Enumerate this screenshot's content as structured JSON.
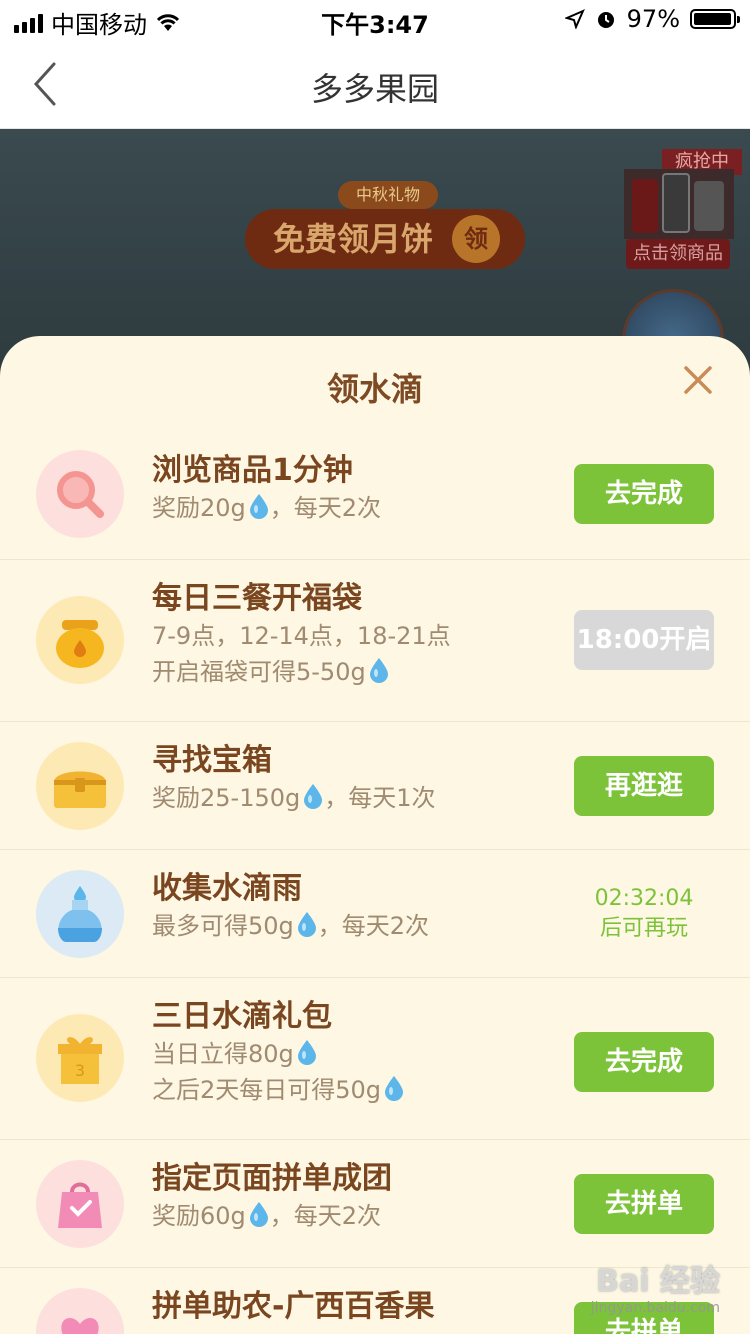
{
  "status_bar": {
    "carrier": "中国移动",
    "time": "下午3:47",
    "battery": "97%",
    "battery_level": 0.97
  },
  "nav": {
    "title": "多多果园"
  },
  "background": {
    "banner_sub": "中秋礼物",
    "banner_main": "免费领月饼",
    "banner_badge": "领",
    "crazy_tag": "疯抢中",
    "click_product": "点击领商品"
  },
  "sheet": {
    "title": "领水滴",
    "tasks": [
      {
        "title": "浏览商品1分钟",
        "desc1": "奖励20g",
        "desc1_suffix": "，每天2次",
        "icon": "magnifier-icon",
        "action": "去完成"
      },
      {
        "title": "每日三餐开福袋",
        "desc1": "7-9点，12-14点，18-21点",
        "desc2": "开启福袋可得5-50g",
        "icon": "lucky-bag-icon",
        "action": "18:00开启"
      },
      {
        "title": "寻找宝箱",
        "desc1": "奖励25-150g",
        "desc1_suffix": "，每天1次",
        "icon": "treasure-chest-icon",
        "action": "再逛逛"
      },
      {
        "title": "收集水滴雨",
        "desc1": "最多可得50g",
        "desc1_suffix": "，每天2次",
        "icon": "water-bottle-icon",
        "timer": "02:32:04",
        "timer_suffix": "后可再玩"
      },
      {
        "title": "三日水滴礼包",
        "desc1": "当日立得80g",
        "desc2": "之后2天每日可得50g",
        "icon": "gift-box-icon",
        "action": "去完成"
      },
      {
        "title": "指定页面拼单成团",
        "desc1": "奖励60g",
        "desc1_suffix": "，每天2次",
        "icon": "shopping-bag-icon",
        "action": "去拼单"
      },
      {
        "title": "拼单助农-广西百香果",
        "icon": "heart-icon",
        "action": "去拼单"
      }
    ]
  },
  "watermark": {
    "logo": "Bai 经验",
    "url": "jingyan.baidu.com"
  }
}
